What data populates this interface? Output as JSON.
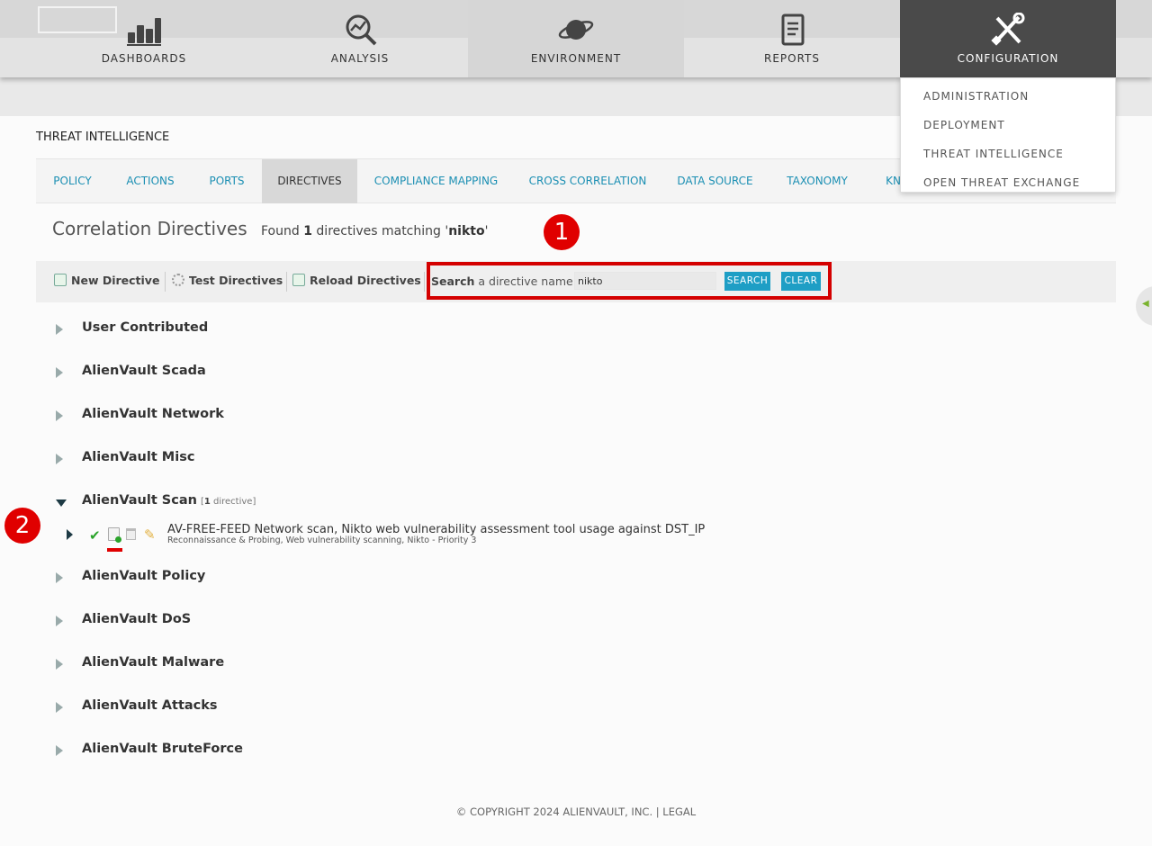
{
  "topnav": {
    "items": [
      {
        "label": "DASHBOARDS",
        "icon": "bar-chart-icon"
      },
      {
        "label": "ANALYSIS",
        "icon": "magnifier-chart-icon"
      },
      {
        "label": "ENVIRONMENT",
        "icon": "planet-icon"
      },
      {
        "label": "REPORTS",
        "icon": "document-icon"
      },
      {
        "label": "CONFIGURATION",
        "icon": "tools-icon"
      }
    ],
    "active": "CONFIGURATION"
  },
  "config_menu": {
    "items": [
      "ADMINISTRATION",
      "DEPLOYMENT",
      "THREAT INTELLIGENCE",
      "OPEN THREAT EXCHANGE"
    ]
  },
  "section_title": "THREAT INTELLIGENCE",
  "tabs": {
    "items": [
      "POLICY",
      "ACTIONS",
      "PORTS",
      "DIRECTIVES",
      "COMPLIANCE MAPPING",
      "CROSS CORRELATION",
      "DATA SOURCE",
      "TAXONOMY",
      "KN"
    ],
    "active": "DIRECTIVES"
  },
  "main": {
    "heading": "Correlation Directives",
    "found_prefix": "Found",
    "found_count": "1",
    "found_middle": "directives matching '",
    "found_term": "nikto",
    "found_suffix": "'"
  },
  "annotations": {
    "badge1": "1",
    "badge2": "2"
  },
  "toolbar": {
    "new_label": "New Directive",
    "test_label": "Test Directives",
    "reload_label": "Reload Directives",
    "search_bold": "Search",
    "search_rest": "a directive name:",
    "search_value": "nikto",
    "search_button": "SEARCH",
    "clear_button": "CLEAR"
  },
  "categories": [
    {
      "name": "User Contributed"
    },
    {
      "name": "AlienVault Scada"
    },
    {
      "name": "AlienVault Network"
    },
    {
      "name": "AlienVault Misc"
    },
    {
      "name": "AlienVault Scan",
      "count_pre": "[",
      "count_num": "1",
      "count_post": " directive]",
      "expanded": true
    },
    {
      "name": "AlienVault Policy"
    },
    {
      "name": "AlienVault DoS"
    },
    {
      "name": "AlienVault Malware"
    },
    {
      "name": "AlienVault Attacks"
    },
    {
      "name": "AlienVault BruteForce"
    }
  ],
  "directive": {
    "title": "AV-FREE-FEED Network scan, Nikto web vulnerability assessment tool usage against DST_IP",
    "subtitle": "Reconnaissance & Probing, Web vulnerability scanning, Nikto - Priority 3"
  },
  "footer": {
    "copyright": "© COPYRIGHT 2024 ALIENVAULT, INC. |",
    "legal": "LEGAL"
  },
  "colors": {
    "accent": "#1e9ec5",
    "annotation_red": "#e00000",
    "nav_active": "#4a4a4a"
  }
}
